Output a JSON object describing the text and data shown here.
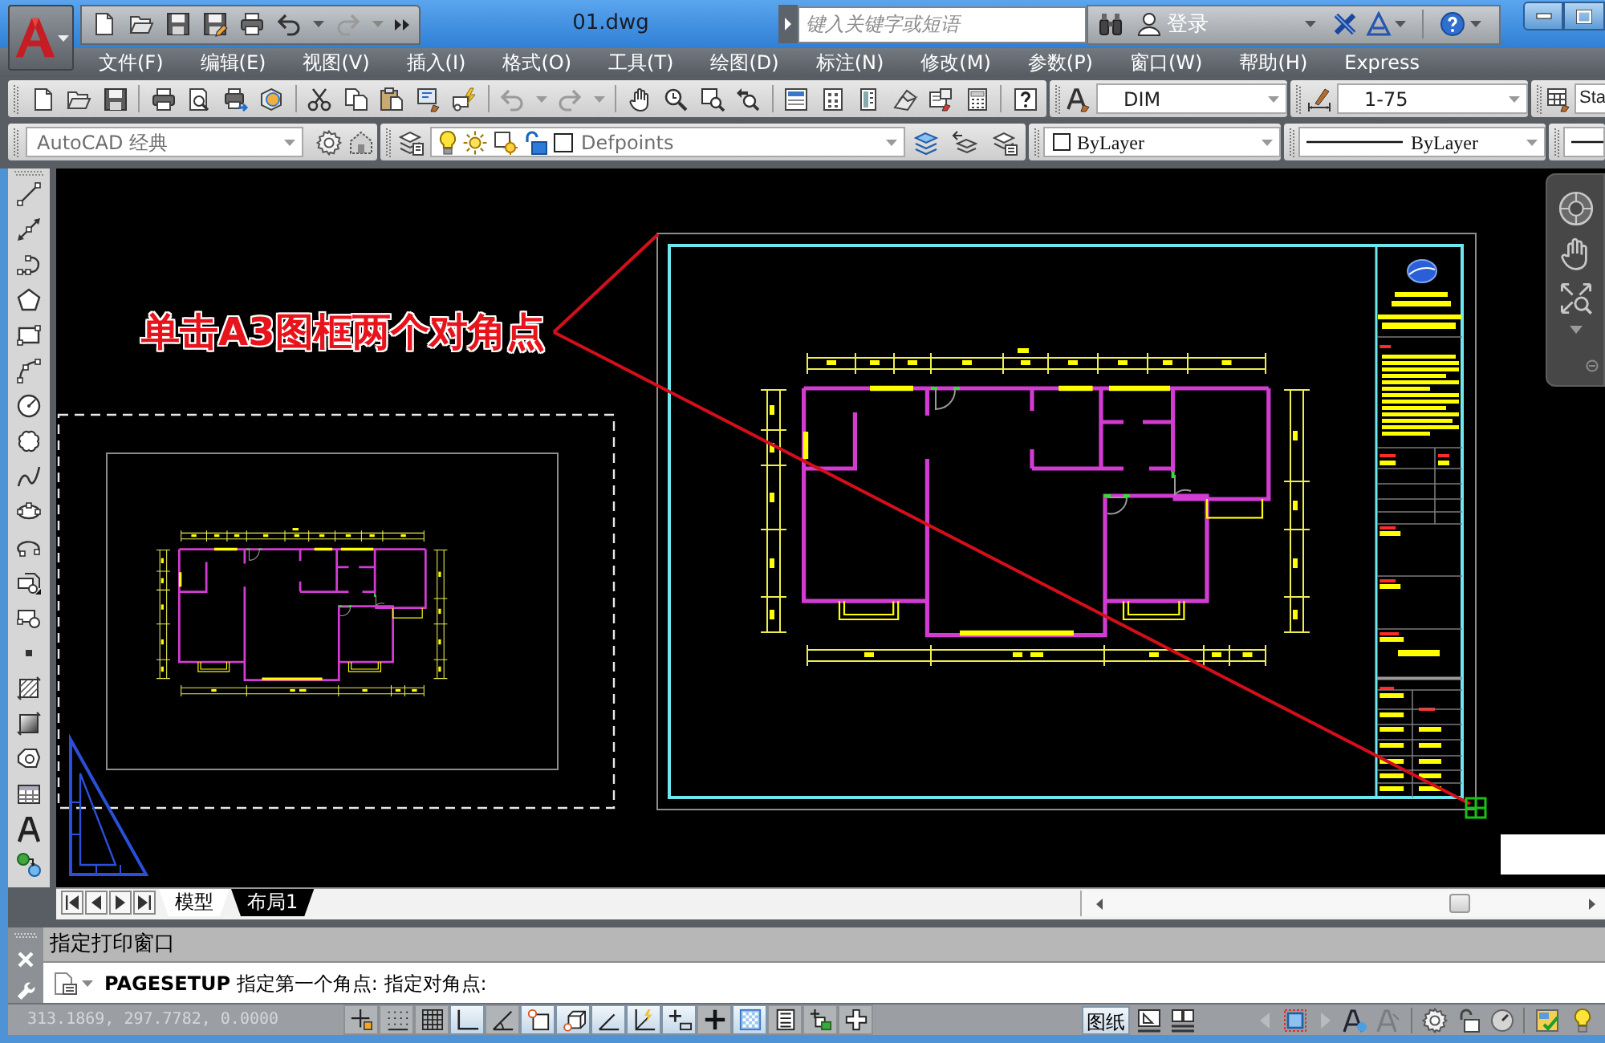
{
  "title_bar": {
    "title": "01.dwg",
    "search": {
      "placeholder": "键入关键字或短语"
    },
    "sign_in": "登录"
  },
  "menu_bar": {
    "items": [
      "文件(F)",
      "编辑(E)",
      "视图(V)",
      "插入(I)",
      "格式(O)",
      "工具(T)",
      "绘图(D)",
      "标注(N)",
      "修改(M)",
      "参数(P)",
      "窗口(W)",
      "帮助(H)",
      "Express"
    ]
  },
  "toolbars": {
    "text_style": "DIM",
    "dimension_style": "1-75",
    "table_style": "Sta",
    "workspace": "AutoCAD 经典",
    "layer": "Defpoints",
    "object_color": "ByLayer",
    "linetype": "ByLayer"
  },
  "drawing": {
    "annotation": "单击A3图框两个对角点"
  },
  "layout_tabs": [
    {
      "label": "模型",
      "selected": false
    },
    {
      "label": "布局1",
      "selected": true
    }
  ],
  "command_line": {
    "history": "指定打印窗口",
    "prompt": "**PAGESETUP** 指定第一个角点: 指定对角点:"
  },
  "status_bar": {
    "coordinates": "313.1869, 297.7782, 0.0000",
    "toggles": [
      {
        "kind": "infer",
        "on": false
      },
      {
        "kind": "snap",
        "on": false
      },
      {
        "kind": "grid",
        "on": false
      },
      {
        "kind": "ortho",
        "on": true
      },
      {
        "kind": "polar",
        "on": false
      },
      {
        "kind": "osnap",
        "on": true
      },
      {
        "kind": "threedosnap",
        "on": true
      },
      {
        "kind": "otrack",
        "on": true
      },
      {
        "kind": "ducs",
        "on": true
      },
      {
        "kind": "dyn",
        "on": true
      },
      {
        "kind": "lwt",
        "on": false
      },
      {
        "kind": "tpy",
        "on": true
      },
      {
        "kind": "qp",
        "on": false
      },
      {
        "kind": "sc",
        "on": false
      },
      {
        "kind": "am",
        "on": false
      }
    ],
    "space": "图纸"
  }
}
